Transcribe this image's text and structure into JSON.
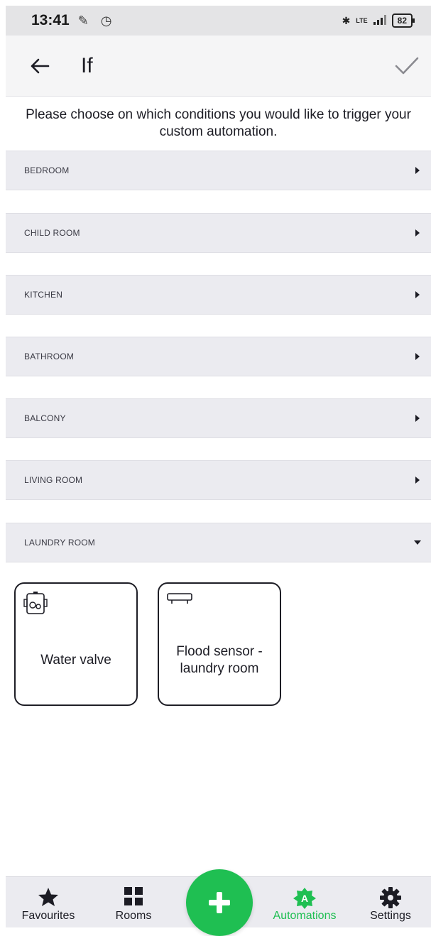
{
  "status_bar": {
    "time": "13:41",
    "left_icons": "✎ ◷",
    "network": "LTE",
    "battery": "82"
  },
  "header": {
    "title": "If"
  },
  "instructions": "Please choose on which conditions you would like to trigger your custom automation.",
  "rooms": [
    {
      "label": "BEDROOM",
      "expanded": false
    },
    {
      "label": "CHILD ROOM",
      "expanded": false
    },
    {
      "label": "KITCHEN",
      "expanded": false
    },
    {
      "label": "BATHROOM",
      "expanded": false
    },
    {
      "label": "BALCONY",
      "expanded": false
    },
    {
      "label": "LIVING ROOM",
      "expanded": false
    },
    {
      "label": "LAUNDRY ROOM",
      "expanded": true
    }
  ],
  "devices": [
    {
      "label": "Water valve",
      "icon": "water-valve-icon"
    },
    {
      "label": "Flood sensor - laundry room",
      "icon": "flood-sensor-icon"
    }
  ],
  "bottom_nav": {
    "items": [
      {
        "label": "Favourites",
        "icon": "star-icon"
      },
      {
        "label": "Rooms",
        "icon": "grid-icon"
      },
      {
        "label": "Automations",
        "icon": "automations-icon",
        "active": true
      },
      {
        "label": "Settings",
        "icon": "gear-icon"
      }
    ],
    "fab_icon": "plus-icon"
  },
  "colors": {
    "accent": "#1fbf52",
    "row_background": "#ebebf0",
    "text": "#1c1c24"
  }
}
